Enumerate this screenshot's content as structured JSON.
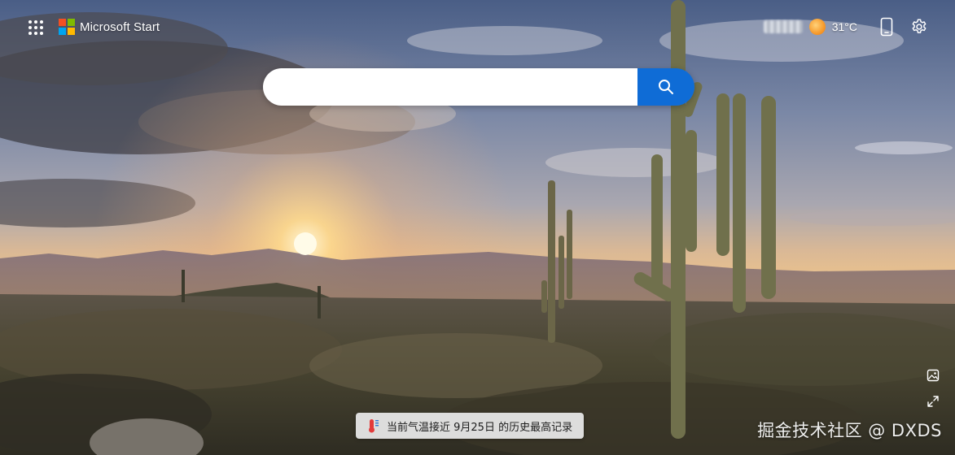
{
  "header": {
    "brand_name": "Microsoft Start",
    "brand_colors": [
      "#f25022",
      "#7fba00",
      "#00a4ef",
      "#ffb900"
    ],
    "apps_icon": "app-launcher-grid-icon",
    "weather": {
      "temperature": "31°C",
      "condition_icon": "sunny-icon"
    },
    "phone_icon": "mobile-phone-icon",
    "settings_icon": "gear-icon"
  },
  "search": {
    "value": "",
    "placeholder": "",
    "button_icon": "search-icon",
    "button_color": "#0f6cd6"
  },
  "background": {
    "image_info_icon": "image-info-icon",
    "expand_icon": "expand-icon"
  },
  "weather_record": {
    "icon": "thermometer-icon",
    "text": "当前气温接近 9月25日 的历史最高记录"
  },
  "watermark": {
    "text": "掘金技术社区 @ DXDS"
  }
}
